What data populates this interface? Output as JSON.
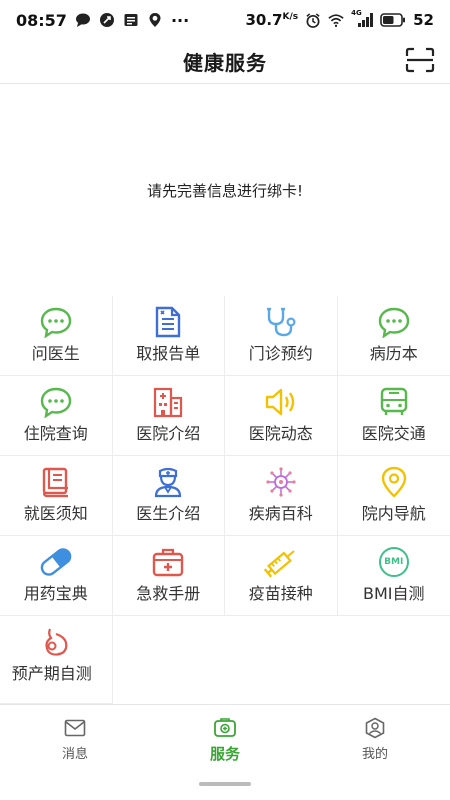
{
  "status_bar": {
    "time": "08:57",
    "dots": "···",
    "speed": "30.7",
    "speed_unit": "K/s",
    "network": "4G",
    "battery": "52"
  },
  "header": {
    "title": "健康服务"
  },
  "notice": {
    "text": "请先完善信息进行绑卡!"
  },
  "services": [
    {
      "label": "问医生",
      "icon": "chat-doctor-icon"
    },
    {
      "label": "取报告单",
      "icon": "report-icon"
    },
    {
      "label": "门诊预约",
      "icon": "stethoscope-icon"
    },
    {
      "label": "病历本",
      "icon": "chat-record-icon"
    },
    {
      "label": "住院查询",
      "icon": "chat-hospital-icon"
    },
    {
      "label": "医院介绍",
      "icon": "hospital-building-icon"
    },
    {
      "label": "医院动态",
      "icon": "speaker-icon"
    },
    {
      "label": "医院交通",
      "icon": "bus-icon"
    },
    {
      "label": "就医须知",
      "icon": "notice-book-icon"
    },
    {
      "label": "医生介绍",
      "icon": "doctor-icon"
    },
    {
      "label": "疾病百科",
      "icon": "virus-icon"
    },
    {
      "label": "院内导航",
      "icon": "location-pin-icon"
    },
    {
      "label": "用药宝典",
      "icon": "pill-icon"
    },
    {
      "label": "急救手册",
      "icon": "first-aid-kit-icon"
    },
    {
      "label": "疫苗接种",
      "icon": "syringe-icon"
    },
    {
      "label": "BMI自测",
      "icon": "bmi-icon",
      "badge": "BMI"
    },
    {
      "label": "预产期自测",
      "icon": "pregnancy-icon"
    }
  ],
  "bottom_nav": [
    {
      "label": "消息",
      "icon": "mail-icon",
      "active": false
    },
    {
      "label": "服务",
      "icon": "service-icon",
      "active": true
    },
    {
      "label": "我的",
      "icon": "profile-icon",
      "active": false
    }
  ],
  "colors": {
    "green": "#56b94c",
    "blue": "#3f6fd6",
    "light_blue": "#5aa9e6",
    "yellow": "#f2c200",
    "red": "#e0574e",
    "purple": "#c06ad8",
    "active_nav": "#3aa535"
  }
}
